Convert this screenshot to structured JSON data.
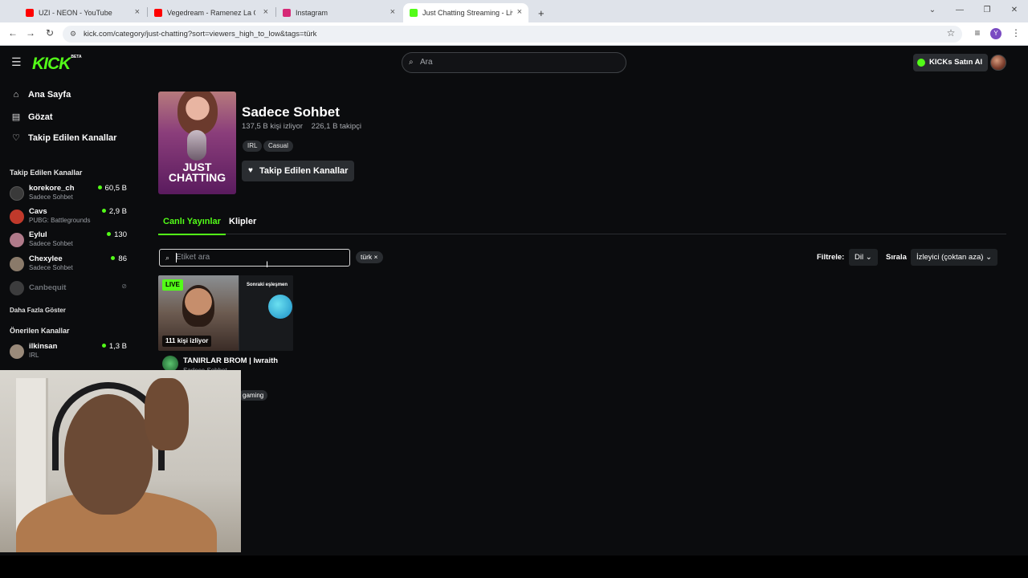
{
  "browser": {
    "tabs": [
      {
        "title": "UZI - NEON - YouTube",
        "favicon_color": "#ff0000"
      },
      {
        "title": "Vegedream - Ramenez La Coupe",
        "favicon_color": "#ff0000"
      },
      {
        "title": "Instagram",
        "favicon_color": "#d62976"
      },
      {
        "title": "Just Chatting Streaming - Live S",
        "favicon_color": "#53fc18",
        "active": true
      }
    ],
    "new_tab": "+",
    "url": "kick.com/category/just-chatting?sort=viewers_high_to_low&tags=türk"
  },
  "header": {
    "logo": "KICK",
    "logo_badge": "BETA",
    "search_placeholder": "Ara",
    "kicks_button": "KICKs Satın Al"
  },
  "sidebar": {
    "main_nav": [
      {
        "label": "Ana Sayfa",
        "icon": "home-icon"
      },
      {
        "label": "Gözat",
        "icon": "browse-icon"
      },
      {
        "label": "Takip Edilen Kanallar",
        "icon": "heart-icon"
      }
    ],
    "followed_title": "Takip Edilen Kanallar",
    "followed": [
      {
        "name": "korekore_ch",
        "category": "Sadece Sohbet",
        "viewers": "60,5 B",
        "avatar_color": "#3a3a3a"
      },
      {
        "name": "Cavs",
        "category": "PUBG: Battlegrounds",
        "viewers": "2,9 B",
        "avatar_color": "#c0392b"
      },
      {
        "name": "Eylul",
        "category": "Sadece Sohbet",
        "viewers": "130",
        "avatar_color": "#b07a8a"
      },
      {
        "name": "Chexylee",
        "category": "Sadece Sohbet",
        "viewers": "86",
        "avatar_color": "#8a7a6a"
      }
    ],
    "offline": {
      "name": "Canbequit"
    },
    "show_more": "Daha Fazla Göster",
    "recommended_title": "Önerilen Kanallar",
    "recommended": [
      {
        "name": "ilkinsan",
        "category": "IRL",
        "viewers": "1,3 B",
        "avatar_color": "#9a8a7a"
      }
    ]
  },
  "category": {
    "cover_text": "JUST CHATTING",
    "title": "Sadece Sohbet",
    "viewers": "137,5 B kişi izliyor",
    "followers": "226,1 B takipçi",
    "tags": [
      "IRL",
      "Casual"
    ],
    "follow_button": "Takip Edilen Kanallar"
  },
  "tabs": [
    {
      "label": "Canlı Yayınlar",
      "active": true
    },
    {
      "label": "Klipler",
      "active": false
    }
  ],
  "filters": {
    "tag_search_placeholder": "Etiket ara",
    "active_chip": "türk ×",
    "filter_label": "Filtrele:",
    "language_button": "Dil",
    "sort_label": "Sırala",
    "sort_button": "İzleyici (çoktan aza)"
  },
  "streams": [
    {
      "live_badge": "LIVE",
      "viewers": "111 kişi izliyor",
      "title": "TANIRLAR BROM | Iwraith",
      "category": "Sadece Sohbet",
      "thumb_caption": "Sonraki eşleşmen",
      "tag": "gaming"
    }
  ],
  "colors": {
    "accent": "#53fc18",
    "background": "#0b0c0e",
    "chip": "#2a2d31"
  }
}
